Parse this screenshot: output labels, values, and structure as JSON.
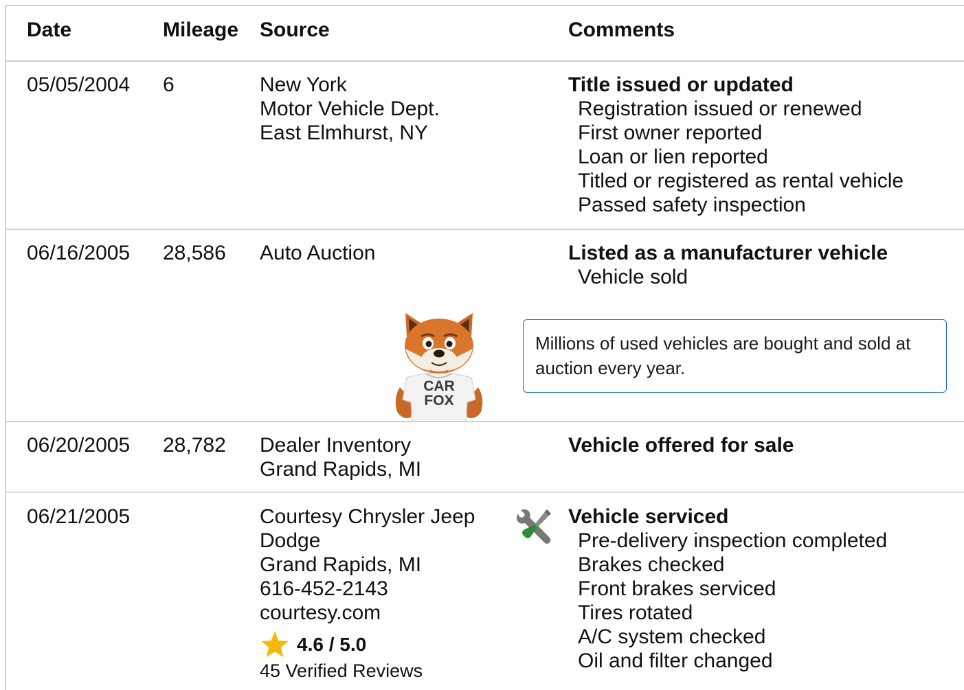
{
  "columns": {
    "date": "Date",
    "mileage": "Mileage",
    "source": "Source",
    "comments": "Comments"
  },
  "records": [
    {
      "date": "05/05/2004",
      "mileage": "6",
      "source": [
        "New York",
        "Motor Vehicle Dept.",
        "East Elmhurst, NY"
      ],
      "comment_title": "Title issued or updated",
      "comment_items": [
        "Registration issued or renewed",
        "First owner reported",
        "Loan or lien reported",
        "Titled or registered as rental vehicle",
        "Passed safety inspection"
      ]
    },
    {
      "date": "06/16/2005",
      "mileage": "28,586",
      "source": [
        "Auto Auction"
      ],
      "comment_title": "Listed as a manufacturer vehicle",
      "comment_items": [
        "Vehicle sold"
      ],
      "tip": "Millions of used vehicles are bought and sold at auction every year."
    },
    {
      "date": "06/20/2005",
      "mileage": "28,782",
      "source": [
        "Dealer Inventory",
        "Grand Rapids, MI"
      ],
      "comment_title": "Vehicle offered for sale",
      "comment_items": []
    },
    {
      "date": "06/21/2005",
      "mileage": "",
      "source": [
        "Courtesy Chrysler Jeep",
        "Dodge",
        "Grand Rapids, MI",
        "616-452-2143",
        "courtesy.com"
      ],
      "rating": "4.6 / 5.0",
      "reviews": "45 Verified Reviews",
      "comment_title": "Vehicle serviced",
      "comment_items": [
        "Pre-delivery inspection completed",
        "Brakes checked",
        "Front brakes serviced",
        "Tires rotated",
        "A/C system checked",
        "Oil and filter changed"
      ]
    }
  ],
  "mascot": {
    "shirt_line1": "CAR",
    "shirt_line2": "FOX"
  },
  "icons": {
    "service": "wrench-screwdriver-icon",
    "rating": "star-icon",
    "mascot": "carfox-mascot"
  },
  "colors": {
    "border": "#cfcfcf",
    "tip_border": "#1e6fc7",
    "star": "#f5b90a",
    "tool_green": "#2e8b3a",
    "tool_grey": "#777777",
    "fox_orange": "#d9762c"
  }
}
